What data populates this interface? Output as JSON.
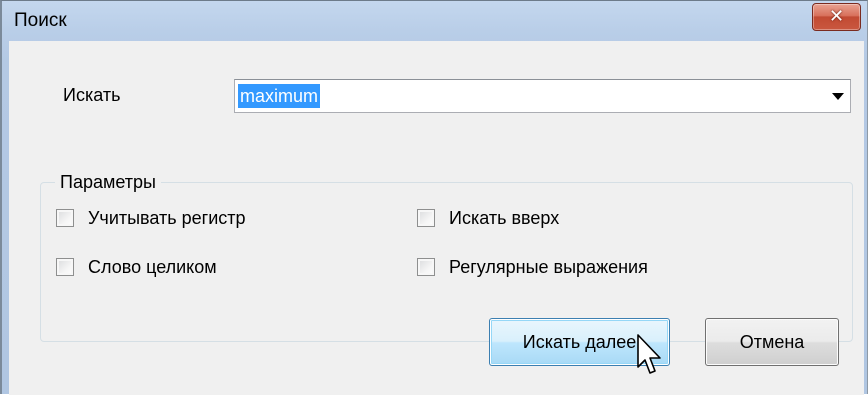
{
  "window": {
    "title": "Поиск",
    "close_symbol": "✕"
  },
  "search": {
    "label": "Искать",
    "value": "maximum"
  },
  "options": {
    "group_title": "Параметры",
    "match_case": {
      "label": "Учитывать регистр",
      "checked": false
    },
    "search_up": {
      "label": "Искать вверх",
      "checked": false
    },
    "whole_word": {
      "label": "Слово целиком",
      "checked": false
    },
    "regex": {
      "label": "Регулярные выражения",
      "checked": false
    }
  },
  "buttons": {
    "find_next": "Искать далее",
    "cancel": "Отмена"
  },
  "colors": {
    "selection": "#3399ff",
    "titlebar": "#b9cee8",
    "close_button": "#c9573f"
  }
}
